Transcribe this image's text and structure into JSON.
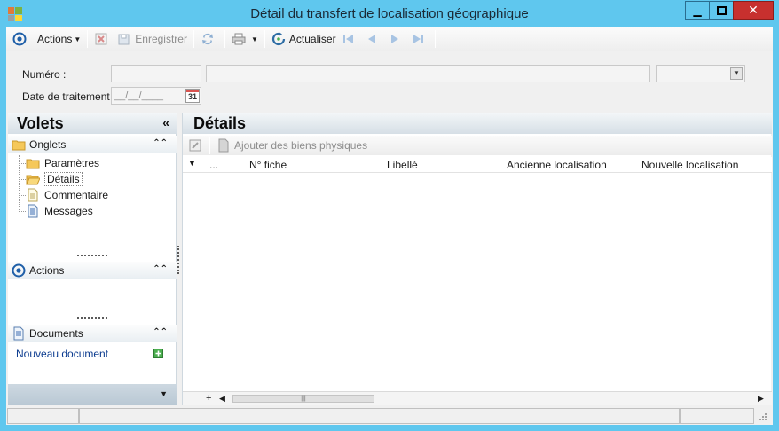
{
  "window": {
    "title": "Détail du transfert de localisation géographique",
    "accent_color": "#5fc7ee",
    "close_color": "#c7302e"
  },
  "toolbar": {
    "actions_label": "Actions",
    "save_label": "Enregistrer",
    "refresh_label": "Actualiser"
  },
  "form": {
    "numero_label": "Numéro :",
    "date_label": "Date de traitement :",
    "date_placeholder": "__/__/____",
    "calendar_day": "31"
  },
  "volets": {
    "title": "Volets",
    "collapse_glyph": "«",
    "onglets": {
      "title": "Onglets",
      "items": [
        {
          "label": "Paramètres",
          "icon": "folder-icon"
        },
        {
          "label": "Détails",
          "icon": "folder-open-icon",
          "selected": true
        },
        {
          "label": "Commentaire",
          "icon": "document-icon"
        },
        {
          "label": "Messages",
          "icon": "document-lines-icon"
        }
      ]
    },
    "actions": {
      "title": "Actions"
    },
    "documents": {
      "title": "Documents",
      "new_document_label": "Nouveau document"
    }
  },
  "details": {
    "title": "Détails",
    "add_label": "Ajouter des biens physiques",
    "columns": [
      "...",
      "N° fiche",
      "Libellé",
      "Ancienne localisation",
      "Nouvelle localisation"
    ],
    "footer_plus": "+"
  }
}
